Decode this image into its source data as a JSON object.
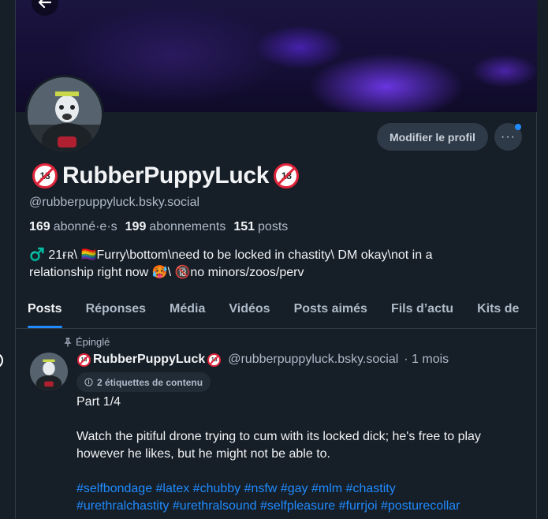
{
  "profile": {
    "display_name": "RubberPuppyLuck",
    "name_emoji": "18",
    "handle": "@rubberpuppyluck.bsky.social",
    "followers_count": "169",
    "followers_label": "abonné·e·s",
    "following_count": "199",
    "following_label": "abonnements",
    "posts_count": "151",
    "posts_label": "posts",
    "bio_line1": "♂️ 21ғʀ\\ 🏳️‍🌈Furry\\bottom\\need to be locked in chastity\\ DM okay\\not in a",
    "bio_line2": "relationship right now 🥵\\ 🔞no minors/zoos/perv"
  },
  "actions": {
    "edit_profile": "Modifier le profil",
    "more": "···"
  },
  "tabs": [
    {
      "label": "Posts"
    },
    {
      "label": "Réponses"
    },
    {
      "label": "Média"
    },
    {
      "label": "Vidéos"
    },
    {
      "label": "Posts aimés"
    },
    {
      "label": "Fils d’actu"
    },
    {
      "label": "Kits de"
    }
  ],
  "post": {
    "pinned_label": "Épinglé",
    "author_name": "RubberPuppyLuck",
    "author_handle": "@rubberpuppyluck.bsky.social",
    "time": "· 1 mois",
    "labels_button": "2 étiquettes de contenu",
    "line1": "Part 1/4",
    "line2": "Watch the pitiful drone trying to cum with its locked dick; he's free to play however he likes, but he might not be able to.",
    "hashtags_line1": "#selfbondage #latex #chubby #nsfw #gay #mlm #chastity",
    "hashtags_line2": "#urethralchastity #urethralsound #selfpleasure #furrjoi #posturecollar"
  },
  "colors": {
    "background": "#161e27",
    "accent": "#208bfe",
    "secondary_text": "#aebbc9"
  }
}
